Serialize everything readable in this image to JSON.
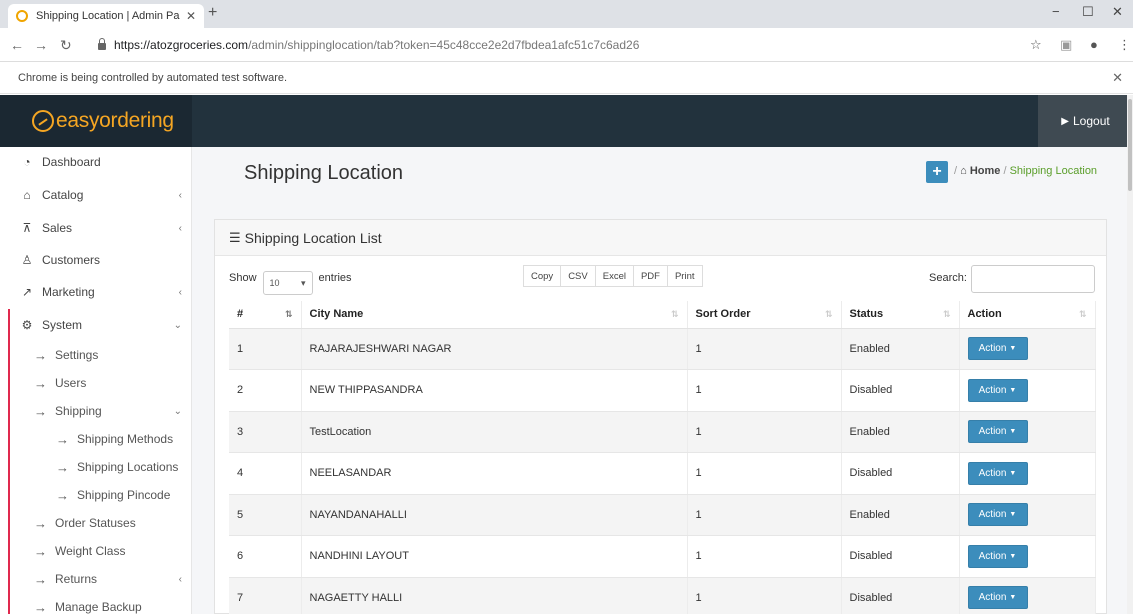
{
  "browser": {
    "tab_title": "Shipping Location | Admin Panel",
    "url_host": "https://atozgroceries.com",
    "url_path": "/admin/shippinglocation/tab?token=45c48cce2e2d7fbdea1afc51c7c6ad26",
    "infobar_text": "Chrome is being controlled by automated test software."
  },
  "header": {
    "logo_text": "easyordering",
    "logout_label": "Logout"
  },
  "sidebar": {
    "items": [
      {
        "label": "Dashboard",
        "icon": "dashboard-icon"
      },
      {
        "label": "Catalog",
        "icon": "tag-icon"
      },
      {
        "label": "Sales",
        "icon": "cart-icon"
      },
      {
        "label": "Customers",
        "icon": "user-icon"
      },
      {
        "label": "Marketing",
        "icon": "share-icon"
      },
      {
        "label": "System",
        "icon": "gear-icon"
      }
    ],
    "system_sub": [
      "Settings",
      "Users",
      "Shipping",
      "Shipping Methods",
      "Shipping Locations",
      "Shipping Pincode",
      "Order Statuses",
      "Weight Class",
      "Returns",
      "Manage Backup"
    ]
  },
  "main": {
    "page_title": "Shipping Location",
    "breadcrumb": {
      "home": "Home",
      "current": "Shipping Location"
    },
    "panel_title": "Shipping Location List",
    "show_label": "Show",
    "entries_value": "10",
    "entries_label": "entries",
    "export_buttons": [
      "Copy",
      "CSV",
      "Excel",
      "PDF",
      "Print"
    ],
    "search_label": "Search:",
    "columns": [
      "#",
      "City Name",
      "Sort Order",
      "Status",
      "Action"
    ],
    "action_label": "Action",
    "rows": [
      {
        "num": "1",
        "city": "RAJARAJESHWARI NAGAR",
        "sort": "1",
        "status": "Enabled"
      },
      {
        "num": "2",
        "city": "NEW THIPPASANDRA",
        "sort": "1",
        "status": "Disabled"
      },
      {
        "num": "3",
        "city": "TestLocation",
        "sort": "1",
        "status": "Enabled"
      },
      {
        "num": "4",
        "city": "NEELASANDAR",
        "sort": "1",
        "status": "Disabled"
      },
      {
        "num": "5",
        "city": "NAYANDANAHALLI",
        "sort": "1",
        "status": "Enabled"
      },
      {
        "num": "6",
        "city": "NANDHINI LAYOUT",
        "sort": "1",
        "status": "Disabled"
      },
      {
        "num": "7",
        "city": "NAGAETTY HALLI",
        "sort": "1",
        "status": "Disabled"
      }
    ]
  },
  "colors": {
    "header_bg": "#22323d",
    "logo_orange": "#f5a623",
    "primary_blue": "#3c8dbc",
    "sidebar_red": "#e0294d",
    "breadcrumb_green": "#5a9e2a"
  }
}
